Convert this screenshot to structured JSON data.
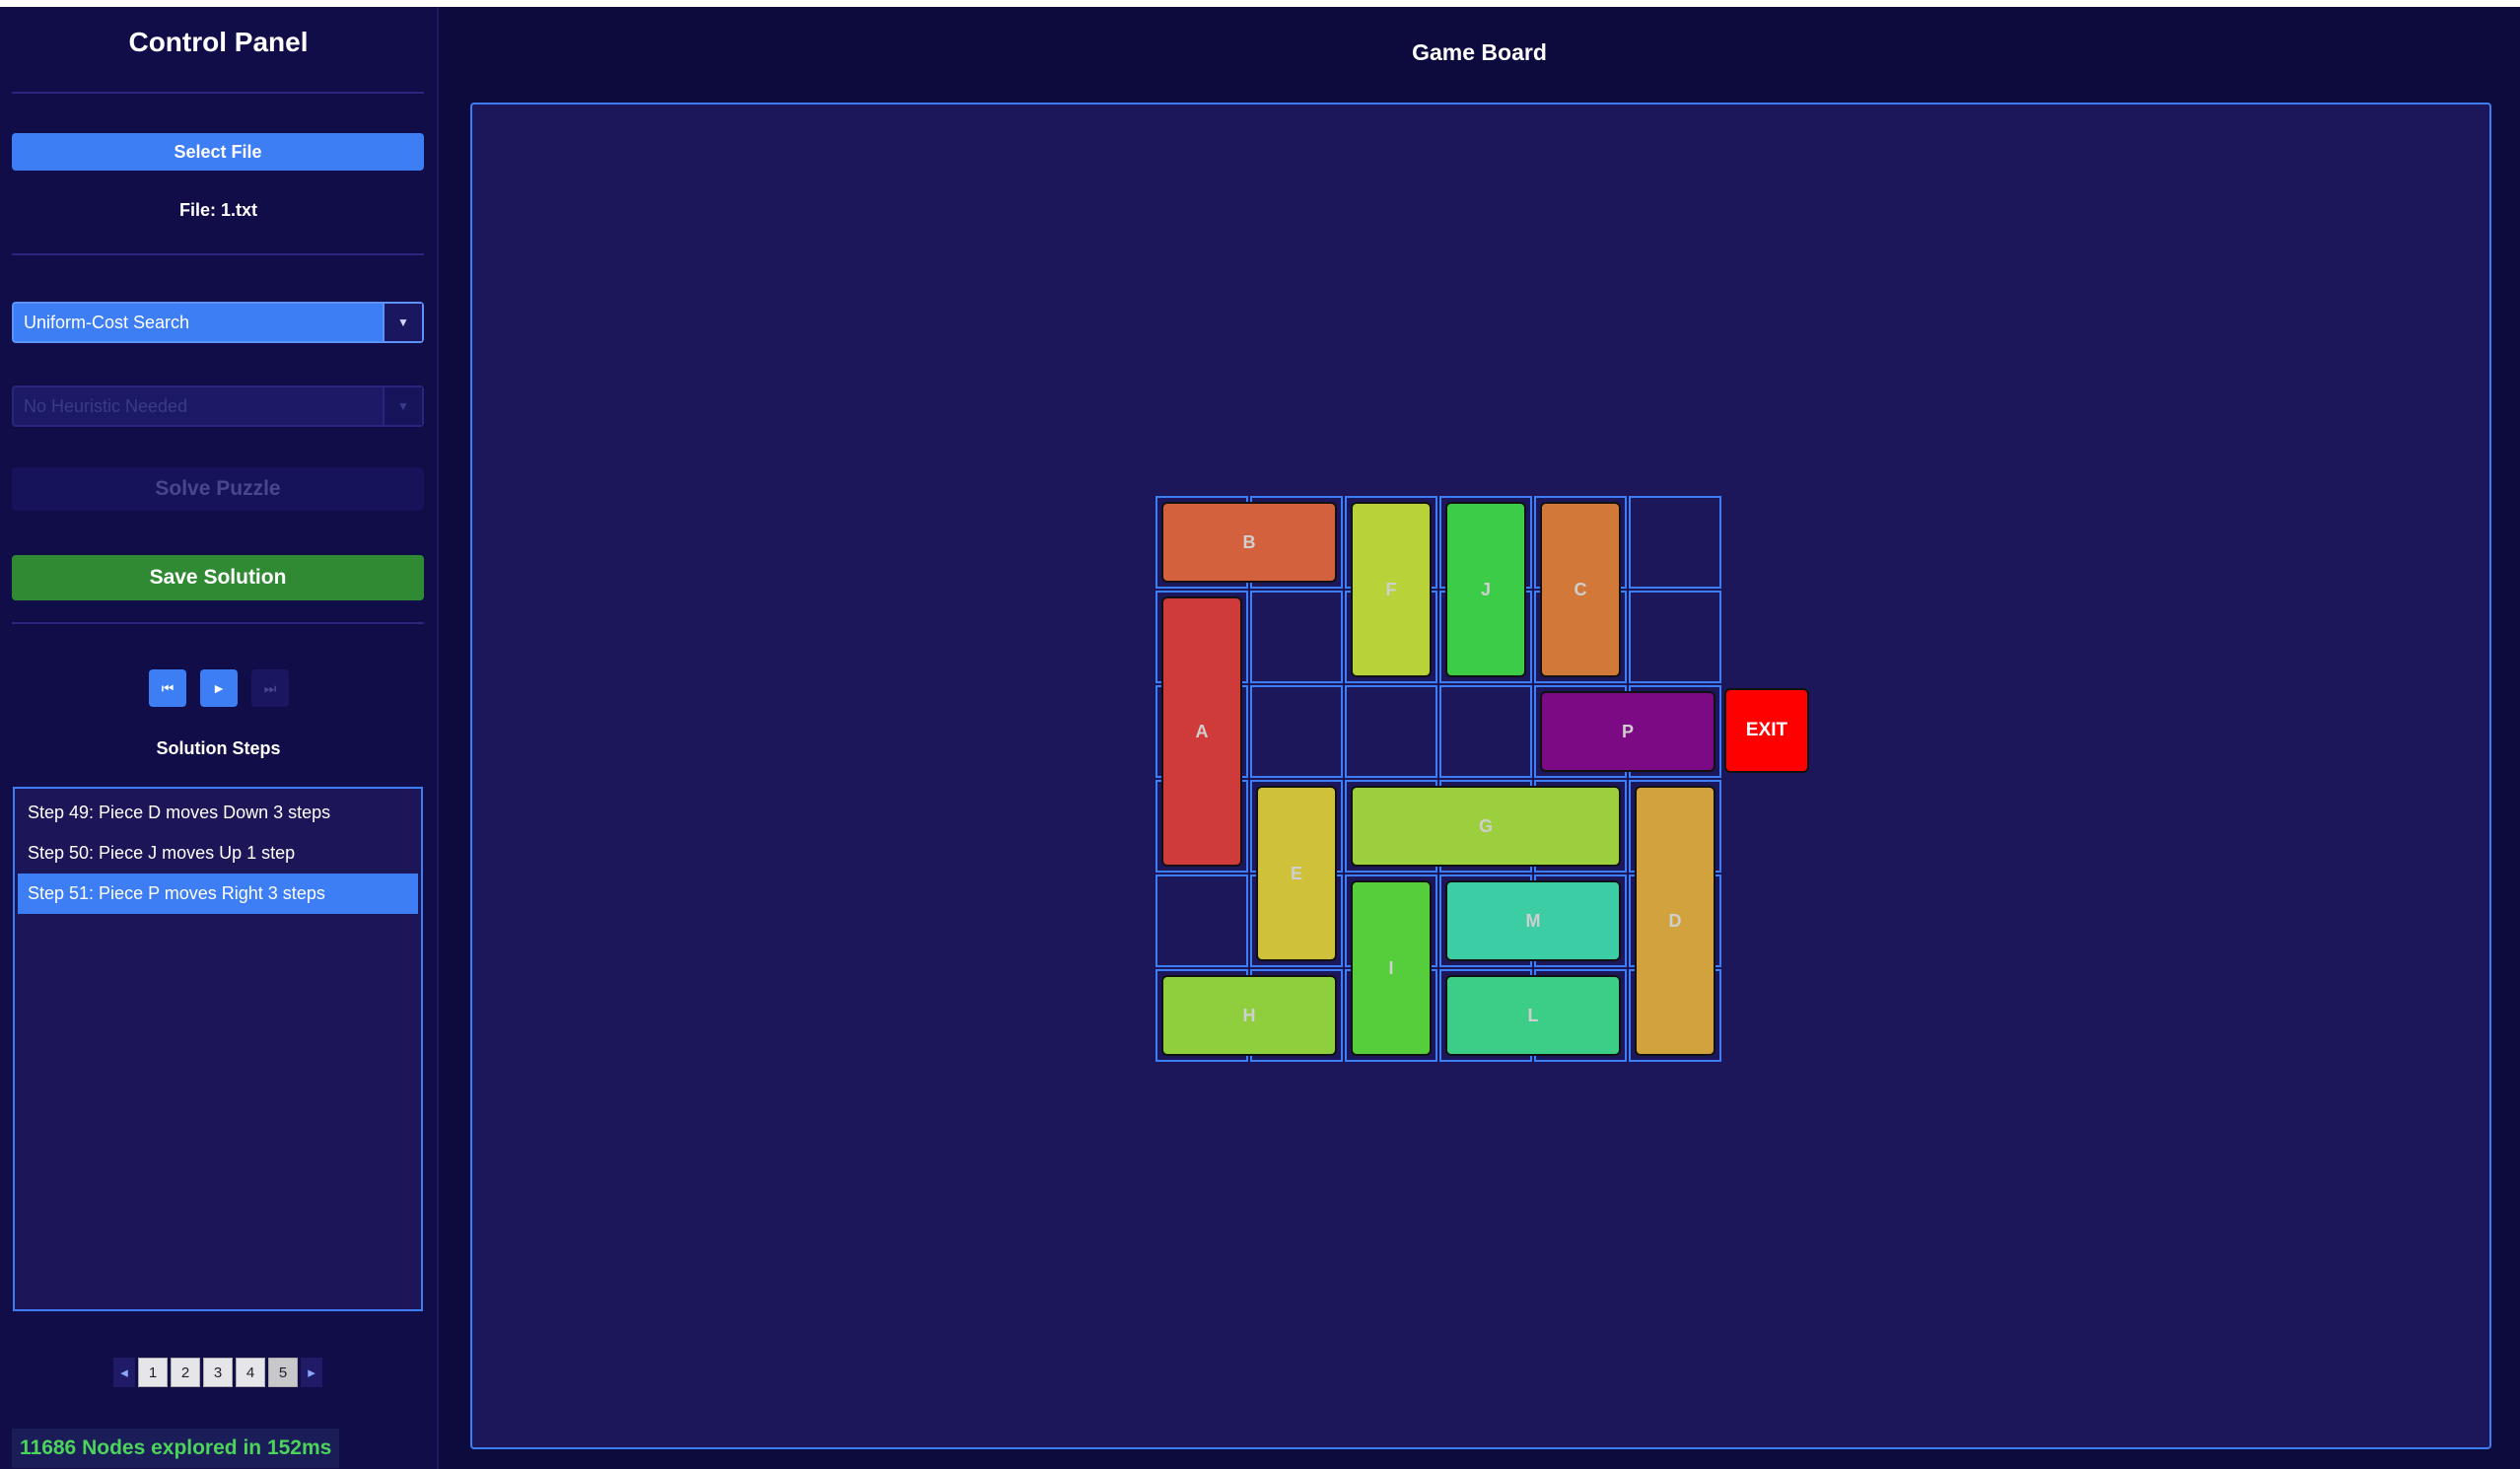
{
  "sidebar": {
    "title": "Control Panel",
    "select_file_label": "Select File",
    "file_label": "File: 1.txt",
    "algorithm": {
      "value": "Uniform-Cost Search"
    },
    "heuristic": {
      "value": "No Heuristic Needed",
      "disabled": true
    },
    "solve_label": "Solve Puzzle",
    "save_label": "Save Solution",
    "playback": {
      "rewind": "⏮",
      "play": "►",
      "end": "⏭"
    },
    "steps_title": "Solution Steps",
    "steps": [
      "Step 49: Piece D moves Down 3 steps",
      "Step 50: Piece J moves Up 1 step",
      "Step 51: Piece P moves Right 3 steps"
    ],
    "active_step": 2,
    "pager": {
      "prev": "◂",
      "next": "▸",
      "pages": [
        "1",
        "2",
        "3",
        "4",
        "5"
      ],
      "current_page": "5"
    },
    "stats": "11686 Nodes explored in 152ms"
  },
  "board": {
    "title": "Game Board",
    "rows": 6,
    "cols": 6,
    "exit_label": "EXIT",
    "exit_row": 2,
    "pieces": [
      {
        "label": "B",
        "row": 0,
        "col": 0,
        "orientation": "horizontal",
        "length": 2,
        "color": "#d4613d"
      },
      {
        "label": "F",
        "row": 0,
        "col": 2,
        "orientation": "vertical",
        "length": 2,
        "color": "#b8d23a"
      },
      {
        "label": "J",
        "row": 0,
        "col": 3,
        "orientation": "vertical",
        "length": 2,
        "color": "#3ccc47"
      },
      {
        "label": "C",
        "row": 0,
        "col": 4,
        "orientation": "vertical",
        "length": 2,
        "color": "#d2793a"
      },
      {
        "label": "A",
        "row": 1,
        "col": 0,
        "orientation": "vertical",
        "length": 3,
        "color": "#cf3a3a"
      },
      {
        "label": "P",
        "row": 2,
        "col": 4,
        "orientation": "horizontal",
        "length": 2,
        "color": "#7d0a85"
      },
      {
        "label": "E",
        "row": 3,
        "col": 1,
        "orientation": "vertical",
        "length": 2,
        "color": "#cfc13a"
      },
      {
        "label": "G",
        "row": 3,
        "col": 2,
        "orientation": "horizontal",
        "length": 3,
        "color": "#9ccf3d"
      },
      {
        "label": "D",
        "row": 3,
        "col": 5,
        "orientation": "vertical",
        "length": 3,
        "color": "#d2a23f"
      },
      {
        "label": "I",
        "row": 4,
        "col": 2,
        "orientation": "vertical",
        "length": 2,
        "color": "#56cd3a"
      },
      {
        "label": "M",
        "row": 4,
        "col": 3,
        "orientation": "horizontal",
        "length": 2,
        "color": "#3ccda4"
      },
      {
        "label": "H",
        "row": 5,
        "col": 0,
        "orientation": "horizontal",
        "length": 2,
        "color": "#8fcf3d"
      },
      {
        "label": "L",
        "row": 5,
        "col": 3,
        "orientation": "horizontal",
        "length": 2,
        "color": "#3ccd86"
      }
    ]
  }
}
